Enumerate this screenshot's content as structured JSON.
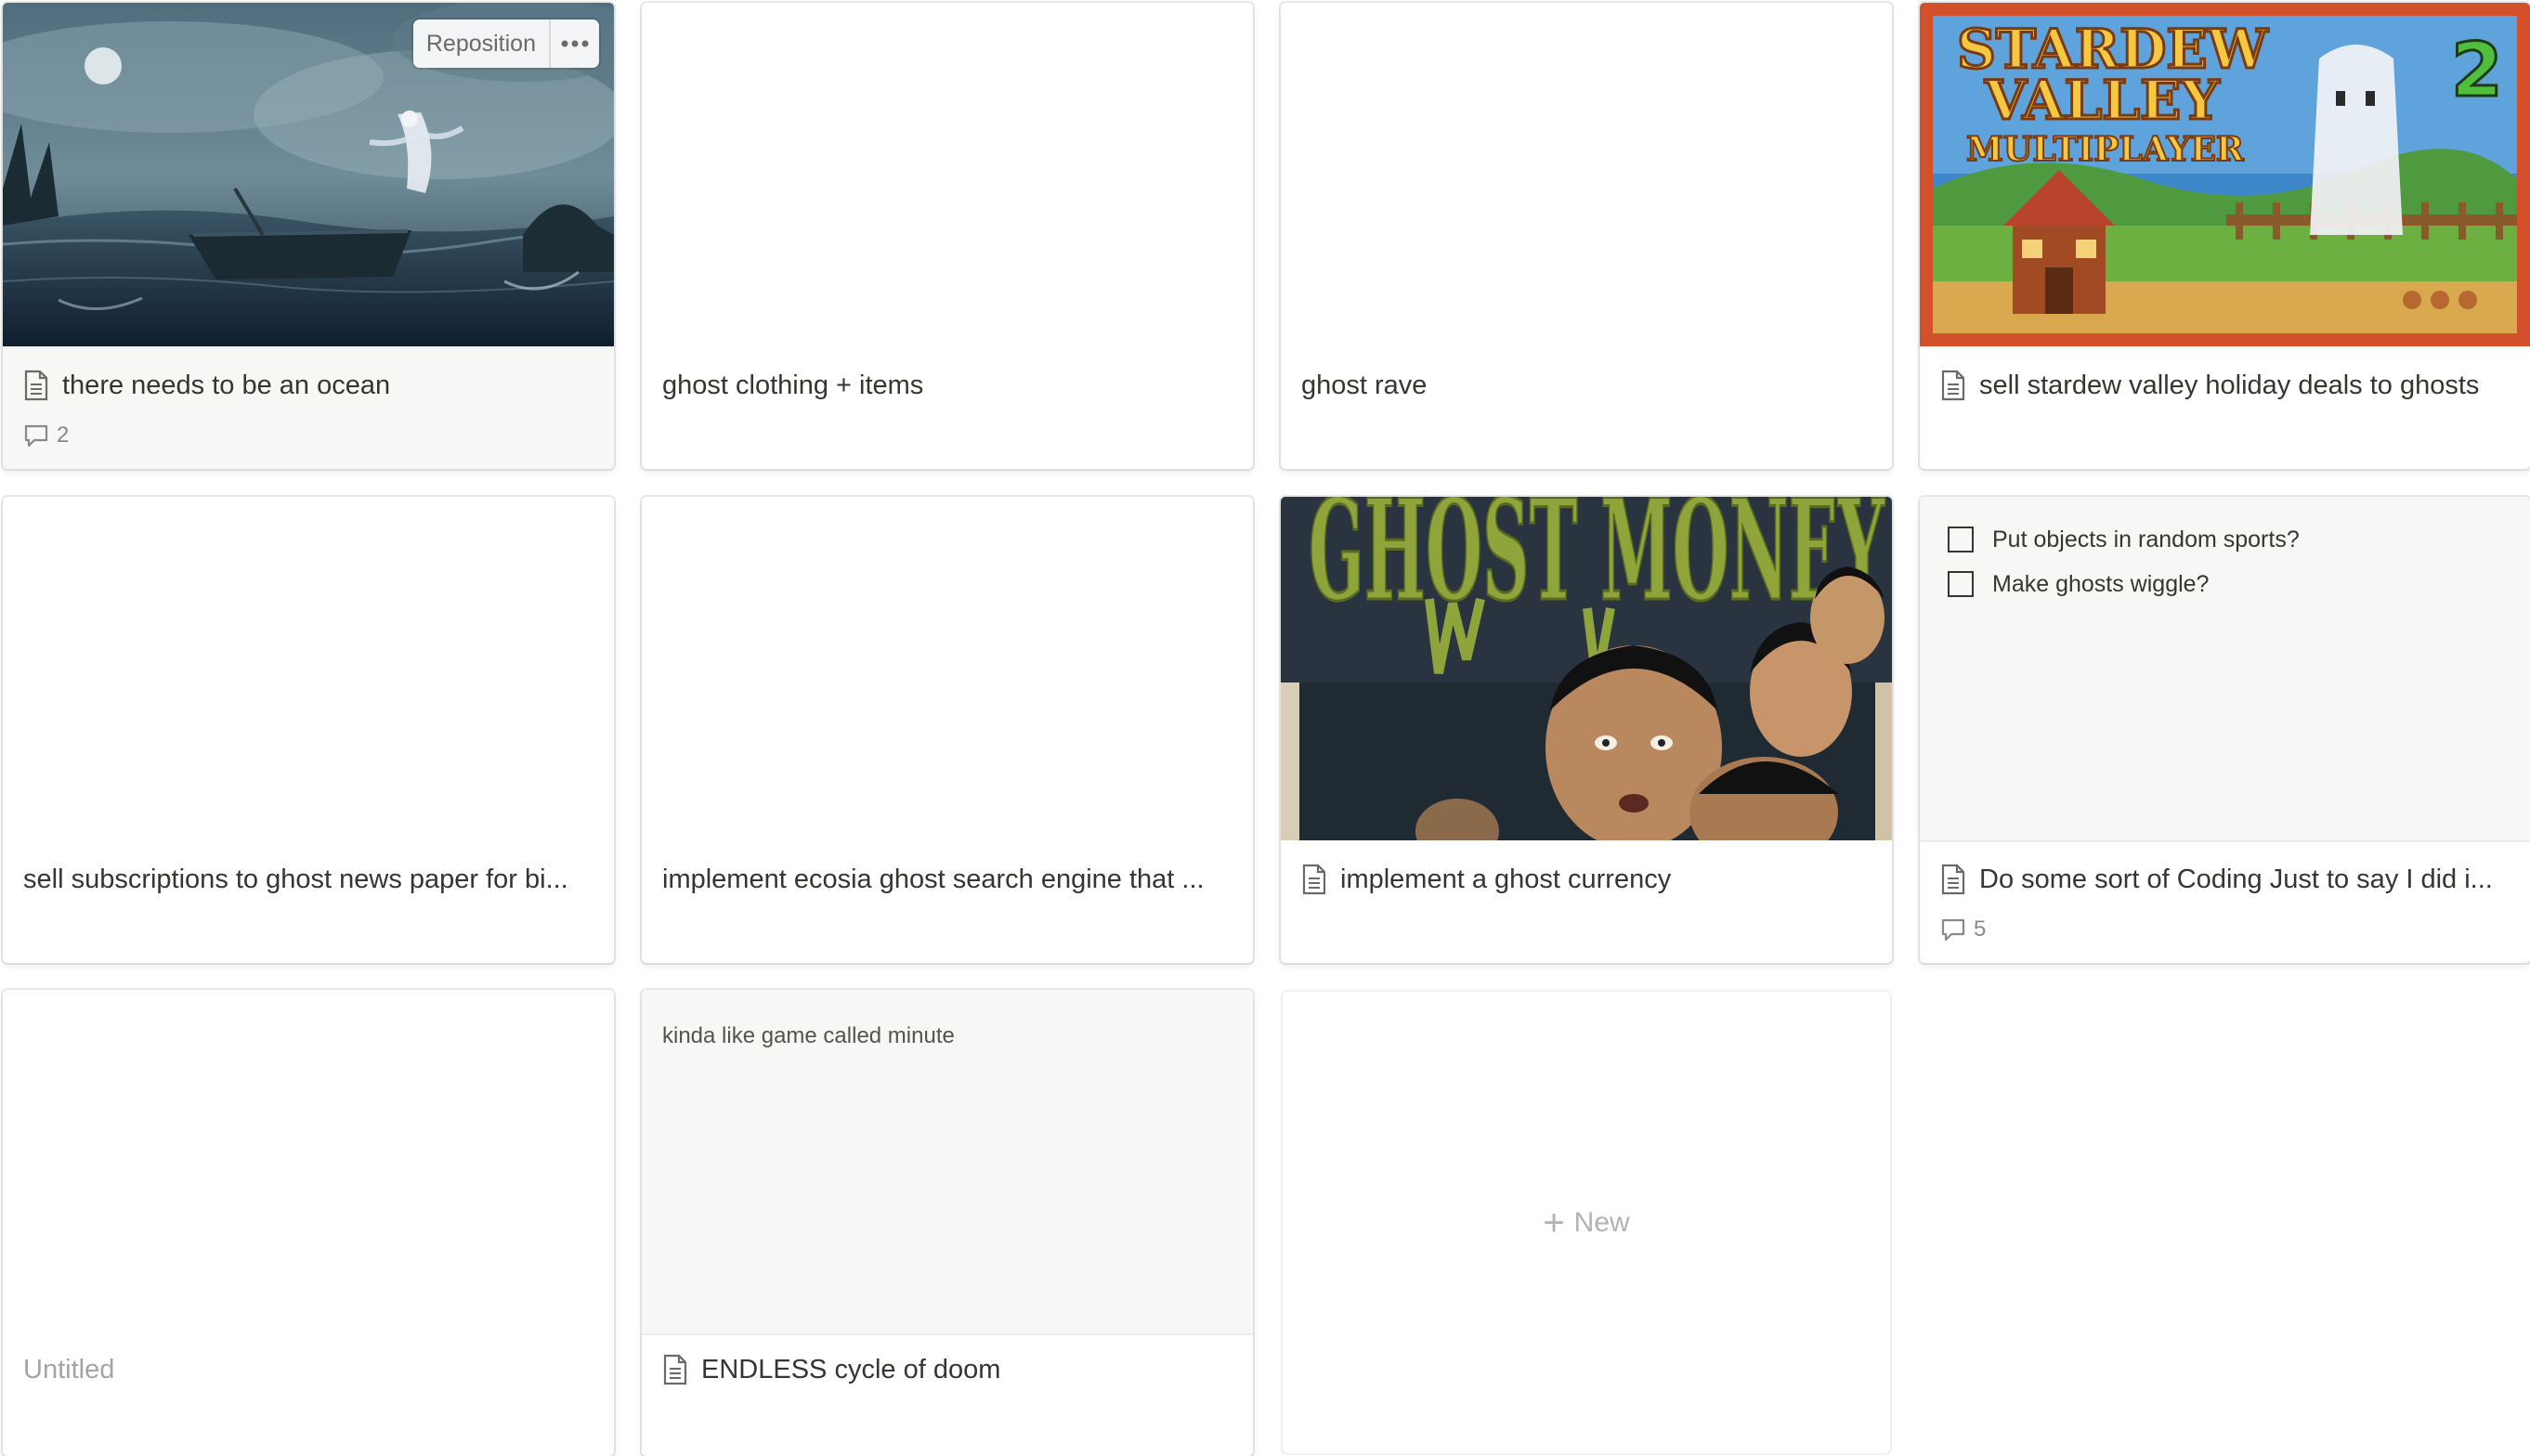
{
  "cards": [
    {
      "title": "there needs to be an ocean",
      "has_page_icon": true,
      "cover": "stormy-ocean-ghost-boat",
      "comment_count": "2",
      "hover_menu": {
        "reposition_label": "Reposition",
        "more_icon": "ellipsis-icon"
      }
    },
    {
      "title": "ghost clothing + items"
    },
    {
      "title": "ghost rave"
    },
    {
      "title": "sell stardew valley holiday deals to ghosts",
      "has_page_icon": true,
      "cover": "stardew-valley-multiplayer-2-ghost",
      "cover_text": {
        "line1": "STARDEW",
        "line2": "VALLEY",
        "line3": "MULTIPLAYER",
        "number": "2"
      }
    },
    {
      "title": "sell subscriptions to ghost news paper for bi..."
    },
    {
      "title": "implement ecosia ghost search engine that ..."
    },
    {
      "title": "implement a ghost currency",
      "has_page_icon": true,
      "cover": "ghost-money-movie-poster",
      "cover_text": "GHOST MONEY"
    },
    {
      "title": "Do some sort of Coding Just to say I did i...",
      "has_page_icon": true,
      "comment_count": "5",
      "checklist": [
        "Put objects in random sports?",
        "Make ghosts wiggle?"
      ]
    },
    {
      "title": "Untitled",
      "placeholder": true
    },
    {
      "title": "ENDLESS cycle of doom",
      "has_page_icon": true,
      "preview_text": "kinda like game called minute"
    }
  ],
  "new_card": {
    "label": "New",
    "icon": "plus-icon"
  },
  "colors": {
    "text": "#37352f",
    "muted": "#8a8985",
    "placeholder": "#a5a4a0",
    "card_border": "rgba(15,15,15,0.09)",
    "stardew_frame": "#d2512a"
  }
}
